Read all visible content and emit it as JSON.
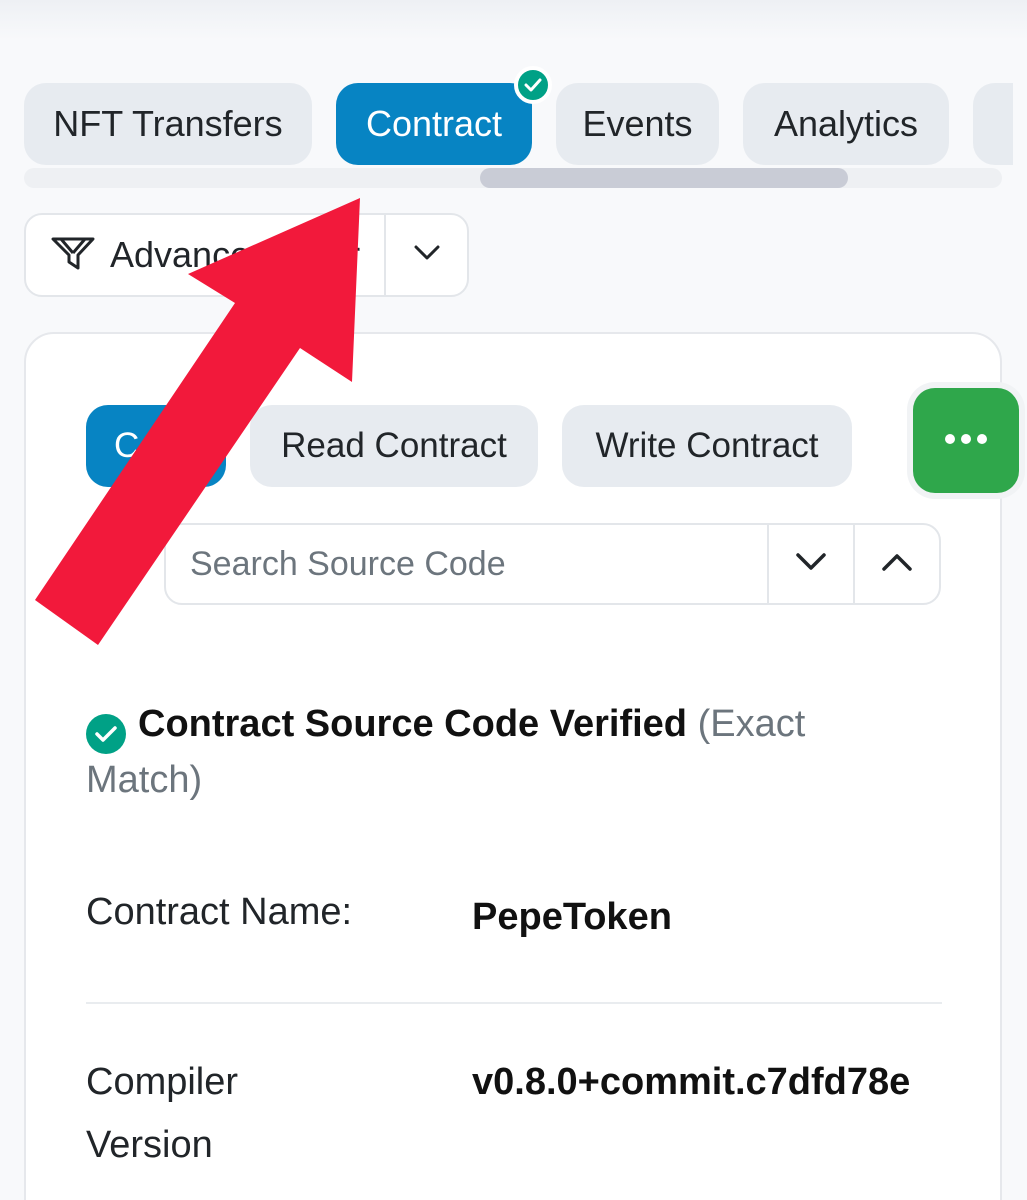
{
  "tabs": [
    {
      "label": "NFT Transfers",
      "active": false
    },
    {
      "label": "Contract",
      "active": true,
      "verified": true
    },
    {
      "label": "Events",
      "active": false
    },
    {
      "label": "Analytics",
      "active": false
    }
  ],
  "filter": {
    "label": "Advanced Filter"
  },
  "subtabs": [
    {
      "label": "Code",
      "active": true
    },
    {
      "label": "Read Contract",
      "active": false
    },
    {
      "label": "Write Contract",
      "active": false
    }
  ],
  "search": {
    "placeholder": "Search Source Code"
  },
  "verification": {
    "title": "Contract Source Code Verified",
    "match": "(Exact Match)"
  },
  "details": {
    "contract_name_label": "Contract Name:",
    "contract_name_value": "PepeToken",
    "compiler_label_1": "Compiler",
    "compiler_label_2": "Version",
    "compiler_value": "v0.8.0+commit.c7dfd78e"
  },
  "colors": {
    "accent": "#0784c3",
    "verified": "#00a186",
    "fab": "#2fa74b",
    "annotation_arrow": "#f2193b"
  },
  "icons": [
    "check-icon",
    "filter-icon",
    "chevron-down-icon",
    "chevron-up-icon",
    "more-dots-icon",
    "annotation-arrow"
  ]
}
